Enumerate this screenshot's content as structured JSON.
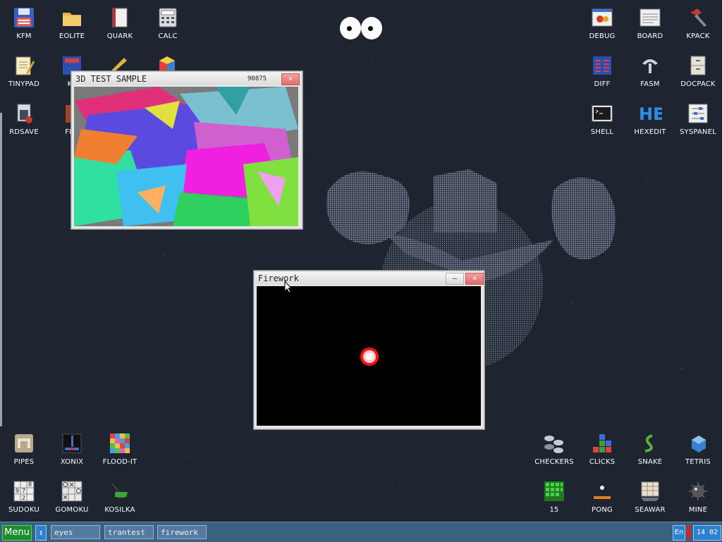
{
  "desktop": {
    "icons_left": [
      {
        "label": "KFM",
        "icon": "floppy-icon"
      },
      {
        "label": "EOLITE",
        "icon": "folder-icon"
      },
      {
        "label": "QUARK",
        "icon": "notebook-icon"
      },
      {
        "label": "CALC",
        "icon": "calculator-icon"
      },
      {
        "label": "TINYPAD",
        "icon": "notepad-icon"
      },
      {
        "label": "KF",
        "icon": "screen-icon"
      },
      {
        "label": "RDSAVE",
        "icon": "rdsave-icon"
      },
      {
        "label": "FB2",
        "icon": "book-icon"
      }
    ],
    "icons_right": [
      {
        "label": "DEBUG",
        "icon": "bug-icon"
      },
      {
        "label": "BOARD",
        "icon": "board-icon"
      },
      {
        "label": "KPACK",
        "icon": "hammer-icon"
      },
      {
        "label": "DIFF",
        "icon": "diff-icon"
      },
      {
        "label": "FASM",
        "icon": "fasm-icon"
      },
      {
        "label": "DOCPACK",
        "icon": "cabinet-icon"
      },
      {
        "label": "SHELL",
        "icon": "terminal-icon"
      },
      {
        "label": "HEXEDIT",
        "icon": "hexedit-icon"
      },
      {
        "label": "SYSPANEL",
        "icon": "sliders-icon"
      }
    ],
    "icons_bottom_left": [
      {
        "label": "PIPES",
        "icon": "pipes-icon"
      },
      {
        "label": "XONIX",
        "icon": "xonix-icon"
      },
      {
        "label": "FLOOD-IT",
        "icon": "flood-icon"
      },
      {
        "label": "SUDOKU",
        "icon": "sudoku-icon"
      },
      {
        "label": "GOMOKU",
        "icon": "gomoku-icon"
      },
      {
        "label": "KOSILKA",
        "icon": "mower-icon"
      }
    ],
    "icons_bottom_right": [
      {
        "label": "CHECKERS",
        "icon": "checkers-icon"
      },
      {
        "label": "CLICKS",
        "icon": "clicks-icon"
      },
      {
        "label": "SNAKE",
        "icon": "snake-icon"
      },
      {
        "label": "TETRIS",
        "icon": "tetris-icon"
      },
      {
        "label": "15",
        "icon": "fifteen-icon"
      },
      {
        "label": "PONG",
        "icon": "pong-icon"
      },
      {
        "label": "SEAWAR",
        "icon": "seawar-icon"
      },
      {
        "label": "MINE",
        "icon": "mine-icon"
      }
    ]
  },
  "windows": {
    "test3d": {
      "title": "3D TEST SAMPLE",
      "extra": "90875"
    },
    "firework": {
      "title": "Firework"
    }
  },
  "buttons": {
    "minimize": "–",
    "close": "×"
  },
  "taskbar": {
    "menu_label": "Menu",
    "switch_label": "↕",
    "tasks": [
      "eyes",
      "trantest",
      "firework"
    ],
    "lang": "En",
    "clock": "14 02"
  },
  "colors": {
    "taskbar": "#3a6180",
    "menu": "#1d8f2a",
    "desktop": "#1e2430",
    "accent": "#2f7fd0"
  }
}
